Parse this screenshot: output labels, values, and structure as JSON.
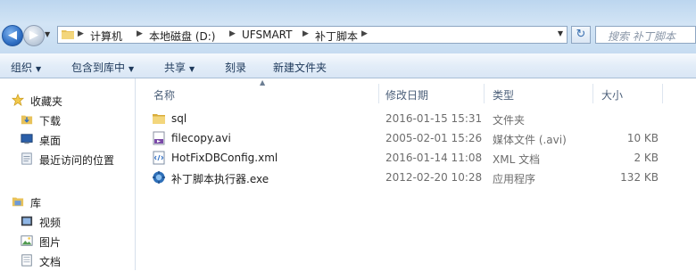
{
  "address": {
    "crumbs": [
      "计算机",
      "本地磁盘 (D:)",
      "UFSMART",
      "补丁脚本"
    ]
  },
  "search": {
    "placeholder": "搜索 补丁脚本"
  },
  "toolbar": {
    "organize": "组织",
    "include_in_library": "包含到库中",
    "share": "共享",
    "burn": "刻录",
    "new_folder": "新建文件夹"
  },
  "nav": {
    "favorites": "收藏夹",
    "downloads": "下载",
    "desktop": "桌面",
    "recent": "最近访问的位置",
    "libraries": "库",
    "videos": "视频",
    "pictures": "图片",
    "documents": "文档"
  },
  "columns": {
    "name": "名称",
    "modified": "修改日期",
    "type": "类型",
    "size": "大小"
  },
  "files": [
    {
      "name": "sql",
      "modified": "2016-01-15 15:31",
      "type": "文件夹",
      "size": "",
      "icon": "folder-icon"
    },
    {
      "name": "filecopy.avi",
      "modified": "2005-02-01 15:26",
      "type": "媒体文件 (.avi)",
      "size": "10 KB",
      "icon": "video-file-icon"
    },
    {
      "name": "HotFixDBConfig.xml",
      "modified": "2016-01-14 11:08",
      "type": "XML 文档",
      "size": "2 KB",
      "icon": "xml-file-icon"
    },
    {
      "name": "补丁脚本执行器.exe",
      "modified": "2012-02-20 10:28",
      "type": "应用程序",
      "size": "132 KB",
      "icon": "exe-app-icon"
    }
  ]
}
